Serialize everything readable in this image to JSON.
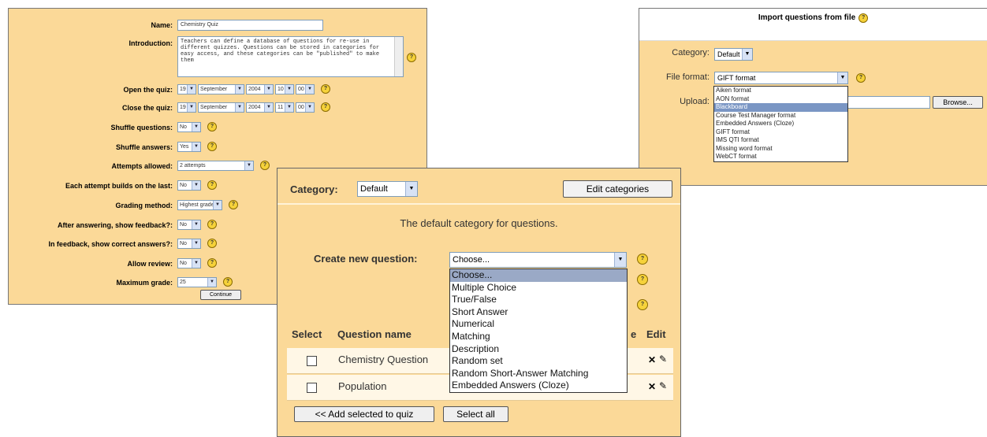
{
  "quiz_settings": {
    "labels": {
      "name": "Name:",
      "introduction": "Introduction:",
      "open": "Open the quiz:",
      "close": "Close the quiz:",
      "shuffle_questions": "Shuffle questions:",
      "shuffle_answers": "Shuffle answers:",
      "attempts": "Attempts allowed:",
      "builds": "Each attempt builds on the last:",
      "grading": "Grading method:",
      "feedback": "After answering, show feedback?:",
      "correct": "In feedback, show correct answers?:",
      "review": "Allow review:",
      "max_grade": "Maximum grade:"
    },
    "name_value": "Chemistry Quiz",
    "intro_text": "Teachers can define a database of questions for re-use in different quizzes.  Questions can be stored in categories for easy access, and these categories can be \"published\" to make them",
    "open": {
      "day": "19",
      "month": "September",
      "year": "2004",
      "hour": "10",
      "minute": "00"
    },
    "close": {
      "day": "19",
      "month": "September",
      "year": "2004",
      "hour": "11",
      "minute": "00"
    },
    "shuffle_questions": "No",
    "shuffle_answers": "Yes",
    "attempts": "2 attempts",
    "builds": "No",
    "grading": "Highest grade",
    "feedback": "No",
    "correct": "No",
    "review": "No",
    "max_grade": "25",
    "continue_label": "Continue",
    "help_glyph": "?"
  },
  "import_panel": {
    "title": "Import questions from file",
    "category_label": "Category:",
    "category_value": "Default",
    "file_format_label": "File format:",
    "file_format_value": "GIFT format",
    "upload_label": "Upload:",
    "browse_label": "Browse...",
    "formats": [
      "Aiken format",
      "AON format",
      "Blackboard",
      "Course Test Manager format",
      "Embedded Answers (Cloze)",
      "GIFT format",
      "IMS QTI format",
      "Missing word format",
      "WebCT format"
    ],
    "highlighted_format": "Blackboard"
  },
  "category_panel": {
    "category_label": "Category:",
    "category_value": "Default",
    "edit_categories": "Edit categories",
    "description": "The default category for questions.",
    "create_label": "Create new question:",
    "create_value": "Choose...",
    "question_types": [
      "Choose...",
      "Multiple Choice",
      "True/False",
      "Short Answer",
      "Numerical",
      "Matching",
      "Description",
      "Random set",
      "Random Short-Answer Matching",
      "Embedded Answers (Cloze)"
    ],
    "col_select": "Select",
    "col_name": "Question name",
    "col_type_tail": "e",
    "col_edit": "Edit",
    "rows": [
      "Chemistry Question",
      "Population"
    ],
    "delete_glyph": "✕",
    "edit_glyph": "✎",
    "add_selected": "<< Add selected to quiz",
    "select_all": "Select all"
  },
  "colors": {
    "panel_bg": "#fbd998",
    "highlight": "#7a96c4",
    "help_icon": "#f6d23a"
  }
}
